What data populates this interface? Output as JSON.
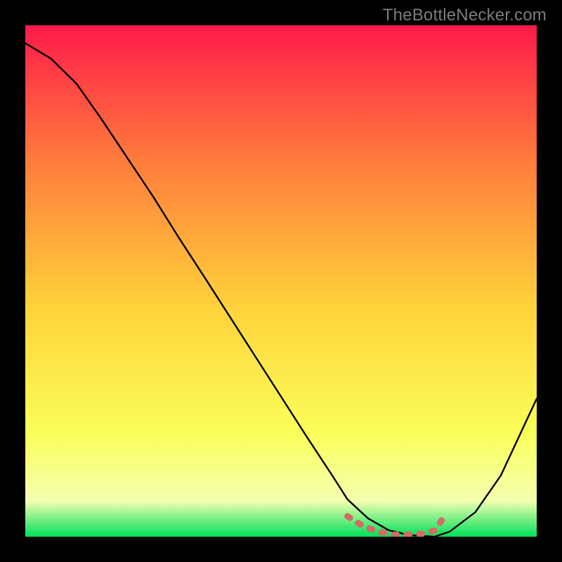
{
  "attribution": "TheBottleNecker.com",
  "colors": {
    "frame": "#000000",
    "grad_top": "#ff1a4b",
    "grad_mid_upper": "#ff7a3c",
    "grad_mid": "#ffd23a",
    "grad_mid_lower": "#faff5a",
    "grad_lower": "#f4ffb0",
    "grad_bottom": "#00e05a",
    "curve": "#000000",
    "secondary_curve": "#d66a65"
  },
  "chart_data": {
    "type": "line",
    "title": "",
    "xlabel": "",
    "ylabel": "",
    "xlim": [
      0,
      1
    ],
    "ylim": [
      0,
      1
    ],
    "series": [
      {
        "name": "primary-curve",
        "x": [
          0.0,
          0.05,
          0.1,
          0.15,
          0.2,
          0.25,
          0.3,
          0.35,
          0.4,
          0.45,
          0.5,
          0.55,
          0.6,
          0.63,
          0.67,
          0.71,
          0.75,
          0.8,
          0.83,
          0.88,
          0.93,
          1.0
        ],
        "y": [
          0.965,
          0.935,
          0.886,
          0.815,
          0.74,
          0.665,
          0.585,
          0.508,
          0.43,
          0.352,
          0.274,
          0.196,
          0.12,
          0.073,
          0.036,
          0.013,
          0.003,
          0.0,
          0.01,
          0.048,
          0.12,
          0.27
        ]
      },
      {
        "name": "secondary-overlay",
        "x": [
          0.63,
          0.66,
          0.69,
          0.72,
          0.75,
          0.78,
          0.8,
          0.82
        ],
        "y": [
          0.04,
          0.021,
          0.01,
          0.004,
          0.004,
          0.006,
          0.012,
          0.04
        ]
      }
    ]
  }
}
